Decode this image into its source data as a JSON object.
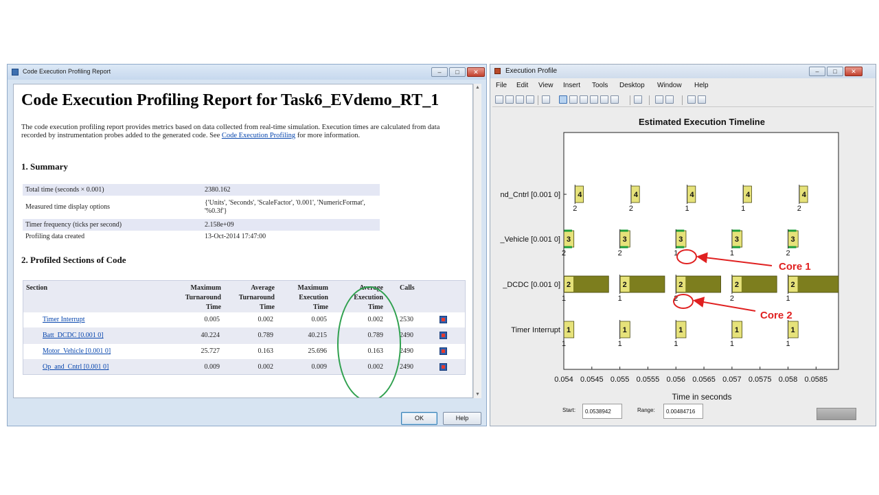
{
  "report_window": {
    "title": "Code Execution Profiling Report",
    "heading": "Code Execution Profiling Report for Task6_EVdemo_RT_1",
    "intro_text": "The code execution profiling report provides metrics based on data collected from real-time simulation. Execution times are calculated from data recorded by instrumentation probes added to the generated code. See",
    "intro_link": "Code Execution Profiling",
    "intro_tail": "for more information.",
    "summary_heading": "1. Summary",
    "summary": [
      {
        "label": "Total time (seconds × 0.001)",
        "value": "2380.162"
      },
      {
        "label": "Measured time display options",
        "value": "{'Units', 'Seconds', 'ScaleFactor', '0.001', 'NumericFormat', '%0.3f'}"
      },
      {
        "label": "Timer frequency (ticks per second)",
        "value": "2.158e+09"
      },
      {
        "label": "Profiling data created",
        "value": "13-Oct-2014 17:47:00"
      }
    ],
    "sections_heading": "2. Profiled Sections of Code",
    "columns": {
      "section": "Section",
      "max_turnaround": "Maximum Turnaround Time",
      "avg_turnaround": "Average Turnaround Time",
      "max_execution": "Maximum Execution Time",
      "avg_execution": "Average Execution Time",
      "calls": "Calls"
    },
    "rows": [
      {
        "section": "Timer Interrupt",
        "max_turnaround": "0.005",
        "avg_turnaround": "0.002",
        "max_execution": "0.005",
        "avg_execution": "0.002",
        "calls": "2530"
      },
      {
        "section": "Batt_DCDC [0.001 0]",
        "max_turnaround": "40.224",
        "avg_turnaround": "0.789",
        "max_execution": "40.215",
        "avg_execution": "0.789",
        "calls": "2490"
      },
      {
        "section": "Motor_Vehicle [0.001 0]",
        "max_turnaround": "25.727",
        "avg_turnaround": "0.163",
        "max_execution": "25.696",
        "avg_execution": "0.163",
        "calls": "2490"
      },
      {
        "section": "Op_and_Cntrl [0.001 0]",
        "max_turnaround": "0.009",
        "avg_turnaround": "0.002",
        "max_execution": "0.009",
        "avg_execution": "0.002",
        "calls": "2490"
      }
    ],
    "ok_label": "OK",
    "help_label": "Help",
    "controls": {
      "minimize": "‒",
      "maximize": "□",
      "close": "✕"
    }
  },
  "profile_window": {
    "title": "Execution Profile",
    "menu": [
      "File",
      "Edit",
      "View",
      "Insert",
      "Tools",
      "Desktop",
      "Window",
      "Help"
    ],
    "start_label": "Start:",
    "start_value": "0.0538942",
    "range_label": "Range:",
    "range_value": "0.00484716",
    "annotation_core1": "Core 1",
    "annotation_core2": "Core 2",
    "colors": {
      "task_fill": "#e6e27a",
      "dcdc_fill": "#7d7e1e",
      "core1_ring": "#e02020",
      "green_mark": "#1f9e3a"
    }
  },
  "chart_data": {
    "type": "timeline",
    "title": "Estimated Execution Timeline",
    "xlabel": "Time in seconds",
    "xlim": [
      0.054,
      0.0589
    ],
    "xticks": [
      "0.054",
      "0.0545",
      "0.055",
      "0.0555",
      "0.056",
      "0.0565",
      "0.057",
      "0.0575",
      "0.058",
      "0.0585"
    ],
    "tracks": [
      {
        "label": "nd_Cntrl [0.001 0]",
        "task_number": "4",
        "events": [
          {
            "start": 0.0542,
            "end": 0.05435,
            "core": "2"
          },
          {
            "start": 0.0552,
            "end": 0.05535,
            "core": "2"
          },
          {
            "start": 0.0562,
            "end": 0.05635,
            "core": "1"
          },
          {
            "start": 0.0572,
            "end": 0.05735,
            "core": "1"
          },
          {
            "start": 0.0582,
            "end": 0.05835,
            "core": "2"
          }
        ]
      },
      {
        "label": "_Vehicle [0.001 0]",
        "task_number": "3",
        "events": [
          {
            "start": 0.054,
            "end": 0.05418,
            "core": "2"
          },
          {
            "start": 0.055,
            "end": 0.05518,
            "core": "2"
          },
          {
            "start": 0.056,
            "end": 0.05618,
            "core": "1"
          },
          {
            "start": 0.057,
            "end": 0.05718,
            "core": "1"
          },
          {
            "start": 0.058,
            "end": 0.05818,
            "core": "2"
          }
        ]
      },
      {
        "label": "_DCDC [0.001 0]",
        "task_number": "2",
        "events": [
          {
            "start": 0.054,
            "end": 0.0548,
            "core": "1"
          },
          {
            "start": 0.055,
            "end": 0.0558,
            "core": "1"
          },
          {
            "start": 0.056,
            "end": 0.0568,
            "core": "2"
          },
          {
            "start": 0.057,
            "end": 0.0578,
            "core": "2"
          },
          {
            "start": 0.058,
            "end": 0.0589,
            "core": "1"
          }
        ]
      },
      {
        "label": "Timer Interrupt",
        "task_number": "1",
        "events": [
          {
            "start": 0.054,
            "end": 0.05418,
            "core": "1"
          },
          {
            "start": 0.055,
            "end": 0.05518,
            "core": "1"
          },
          {
            "start": 0.056,
            "end": 0.05618,
            "core": "1"
          },
          {
            "start": 0.057,
            "end": 0.05718,
            "core": "1"
          },
          {
            "start": 0.058,
            "end": 0.05818,
            "core": "1"
          }
        ]
      }
    ]
  }
}
